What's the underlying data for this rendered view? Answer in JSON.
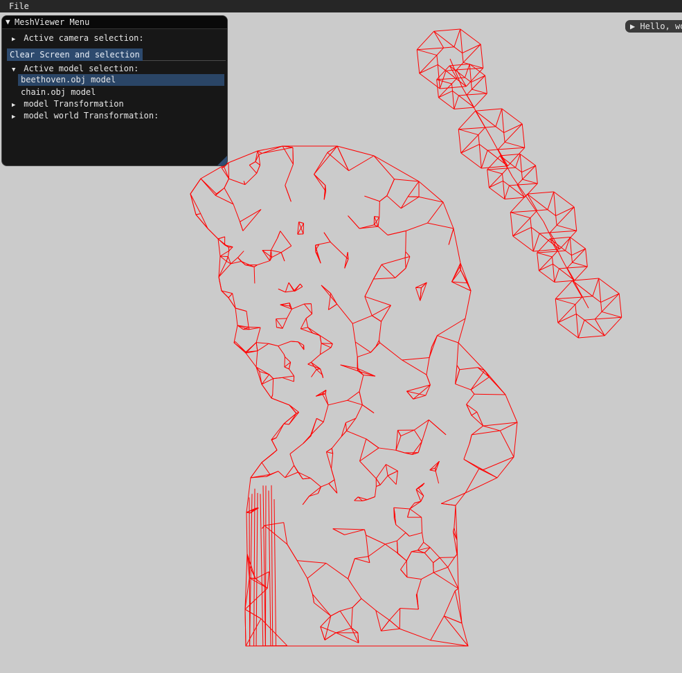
{
  "menubar": {
    "file_label": "File"
  },
  "panel": {
    "title": "MeshViewer Menu",
    "camera_section": "Active camera selection:",
    "clear_button": "Clear Screen and selection",
    "model_section": "Active model selection:",
    "models": [
      "beethoven.obj model",
      "chain.obj model"
    ],
    "selected_model": "beethoven.obj model",
    "model_transformation": "model Transformation",
    "world_transformation": "model world Transformation:"
  },
  "hello_window": {
    "label": "Hello, wo"
  },
  "scene": {
    "mesh_color": "#ff0000",
    "background": "#cbcbcb",
    "wireframe": true
  }
}
